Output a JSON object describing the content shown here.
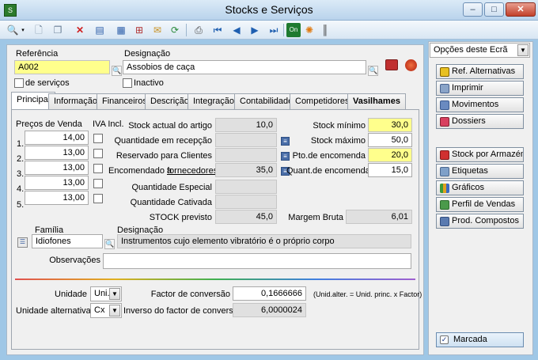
{
  "window": {
    "title": "Stocks e Serviços",
    "minimize": "–",
    "maximize": "□",
    "close": "✕"
  },
  "toolbar": {
    "icons": [
      "search-icon",
      "new-document-icon",
      "copy-icon",
      "delete-icon",
      "properties-icon",
      "grid-icon",
      "hierarchy-icon",
      "email-icon",
      "refresh-icon",
      "print-preview-icon",
      "first-record-icon",
      "previous-record-icon",
      "next-record-icon",
      "last-record-icon",
      "toggle-icon",
      "color-wheel-icon",
      "barcode-icon"
    ]
  },
  "header": {
    "referencia_label": "Referência",
    "referencia_value": "A002",
    "designacao_label": "Designação",
    "designacao_value": "Assobios de caça",
    "servicos_label": "de serviços",
    "inactivo_label": "Inactivo"
  },
  "tabs": [
    {
      "label": "Principal",
      "active": true
    },
    {
      "label": "Informação"
    },
    {
      "label": "Financeiros"
    },
    {
      "label": "Descrição"
    },
    {
      "label": "Integração"
    },
    {
      "label": "Contabilidade"
    },
    {
      "label": "Competidores"
    },
    {
      "label": "Vasilhames"
    }
  ],
  "prices": {
    "title": "Preços de Venda",
    "iva_label": "IVA Incl.",
    "rows": [
      {
        "n": "1.",
        "v": "14,00"
      },
      {
        "n": "2.",
        "v": "13,00"
      },
      {
        "n": "3.",
        "v": "13,00"
      },
      {
        "n": "4.",
        "v": "13,00"
      },
      {
        "n": "5.",
        "v": "13,00"
      }
    ]
  },
  "stock": {
    "actual_label": "Stock actual do artigo",
    "actual": "10,0",
    "recepcao_label": "Quantidade em recepção",
    "recepcao": "",
    "reservado_label": "Reservado para Clientes",
    "reservado": "",
    "encomendado_label": "Encomendado a",
    "encomendado_link": "fornecedores",
    "encomendado": "35,0",
    "especial_label": "Quantidade Especial",
    "especial": "",
    "cativada_label": "Quantidade Cativada",
    "cativada": "",
    "previsto_label": "STOCK previsto",
    "previsto": "45,0"
  },
  "limits": {
    "minimo_label": "Stock mínimo",
    "minimo": "30,0",
    "maximo_label": "Stock máximo",
    "maximo": "50,0",
    "pto_label": "Pto.de encomenda",
    "pto": "20,0",
    "quant_label": "Quant.de encomenda",
    "quant": "15,0",
    "margem_label": "Margem Bruta",
    "margem": "6,01"
  },
  "familia": {
    "label": "Família",
    "value": "Idiofones",
    "desig_label": "Designação",
    "desig_value": "Instrumentos cujo elemento vibratório é o próprio corpo"
  },
  "observacoes_label": "Observações",
  "units": {
    "unidade_label": "Unidade",
    "unidade": "Uni.",
    "alt_label": "Unidade alternativa",
    "alt": "Cx",
    "factor_label": "Factor de conversão",
    "factor": "0,1666666",
    "formula": "(Unid.alter. = Unid. princ. x Factor)",
    "inverso_label": "Inverso do factor de conversão",
    "inverso": "6,0000024"
  },
  "side": {
    "options_label": "Opções deste Ecrã",
    "buttons": [
      "Ref. Alternativas",
      "Imprimir",
      "Movimentos",
      "Dossiers",
      "Stock por Armazém",
      "Etiquetas",
      "Gráficos",
      "Perfil de Vendas",
      "Prod. Compostos"
    ],
    "marcada_label": "Marcada"
  }
}
